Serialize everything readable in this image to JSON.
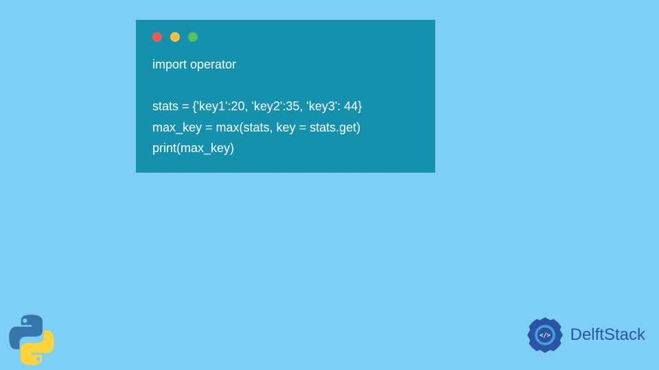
{
  "code": {
    "lines": [
      "import operator",
      "",
      "stats = {'key1':20, 'key2':35, 'key3': 44}",
      "max_key = max(stats, key = stats.get)",
      "print(max_key)"
    ]
  },
  "brand": {
    "name": "DelftStack"
  },
  "colors": {
    "background": "#7ecff5",
    "codeWindow": "#1590ad",
    "dotRed": "#ed594a",
    "dotYellow": "#fdbd41",
    "dotGreen": "#5ac05a",
    "brandText": "#2a55a5"
  }
}
